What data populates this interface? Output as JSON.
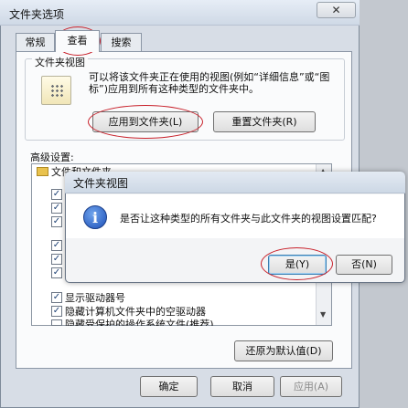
{
  "window": {
    "title": "文件夹选项",
    "close_icon": "✕"
  },
  "tabs": [
    {
      "label": "常规"
    },
    {
      "label": "查看",
      "selected": true
    },
    {
      "label": "搜索"
    }
  ],
  "folder_view": {
    "group_label": "文件夹视图",
    "description": "可以将该文件夹正在使用的视图(例如“详细信息”或“图标”)应用到所有这种类型的文件夹中。",
    "apply_button": "应用到文件夹(L)",
    "reset_button": "重置文件夹(R)"
  },
  "advanced": {
    "label": "高级设置:",
    "tree_root": "文件和文件夹",
    "items": [
      {
        "label": "显示驱动器号",
        "checked": true
      },
      {
        "label": "隐藏计算机文件夹中的空驱动器",
        "checked": true
      },
      {
        "label": "隐藏受保护的操作系统文件(推荐)",
        "checked": true
      }
    ],
    "restore_button": "还原为默认值(D)"
  },
  "footer": {
    "ok": "确定",
    "cancel": "取消",
    "apply": "应用(A)"
  },
  "dialog": {
    "title": "文件夹视图",
    "message": "是否让这种类型的所有文件夹与此文件夹的视图设置匹配?",
    "yes": "是(Y)",
    "no": "否(N)",
    "icon": "info-icon"
  }
}
